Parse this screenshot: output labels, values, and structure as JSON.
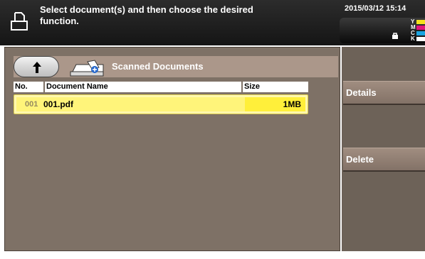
{
  "header": {
    "message": "Select document(s) and then choose the desired function.",
    "datetime": "2015/03/12 15:14",
    "toner": [
      {
        "label": "Y",
        "color": "#f5e21c"
      },
      {
        "label": "M",
        "color": "#e2157b"
      },
      {
        "label": "C",
        "color": "#1aa4e0"
      },
      {
        "label": "K",
        "color": "#ffffff"
      }
    ]
  },
  "toolbar": {
    "folder_title": "Scanned Documents"
  },
  "table": {
    "columns": [
      "No.",
      "Document Name",
      "Size"
    ],
    "rows": [
      {
        "no": "001",
        "name": "001.pdf",
        "size": "1MB"
      }
    ]
  },
  "side": {
    "details_label": "Details",
    "delete_label": "Delete"
  },
  "colors": {
    "panel": "#7e7166",
    "toolbar": "#ab978a",
    "selected_row": "#fff47a"
  }
}
